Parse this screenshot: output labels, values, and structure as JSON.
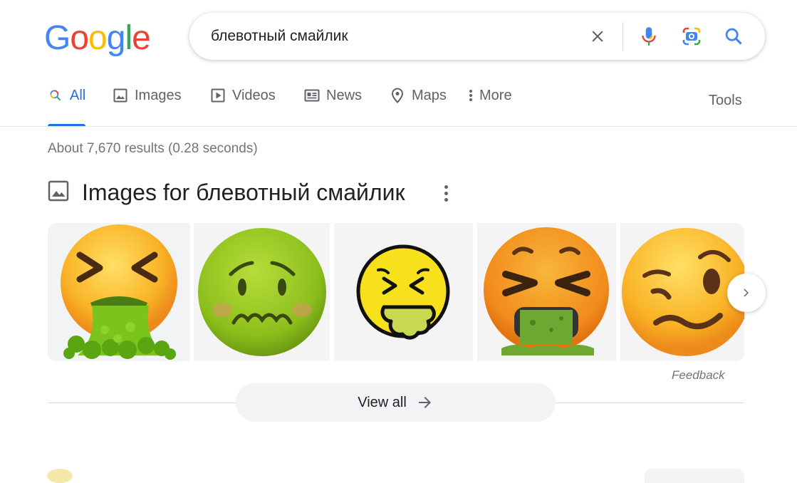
{
  "logo": {
    "letters": [
      {
        "ch": "G",
        "color": "#4285F4"
      },
      {
        "ch": "o",
        "color": "#EA4335"
      },
      {
        "ch": "o",
        "color": "#FBBC05"
      },
      {
        "ch": "g",
        "color": "#4285F4"
      },
      {
        "ch": "l",
        "color": "#34A853"
      },
      {
        "ch": "e",
        "color": "#EA4335"
      }
    ]
  },
  "search": {
    "value": "блевотный смайлик",
    "icons": [
      "clear-icon",
      "microphone-icon",
      "camera-lens-icon",
      "search-icon"
    ]
  },
  "tabs": [
    {
      "label": "All",
      "icon": "search-icon",
      "active": true
    },
    {
      "label": "Images",
      "icon": "image-icon",
      "active": false
    },
    {
      "label": "Videos",
      "icon": "play-icon",
      "active": false
    },
    {
      "label": "News",
      "icon": "newspaper-icon",
      "active": false
    },
    {
      "label": "Maps",
      "icon": "map-pin-icon",
      "active": false
    },
    {
      "label": "More",
      "icon": "more-vertical-icon",
      "active": false
    }
  ],
  "tools_label": "Tools",
  "result_stats": "About 7,670 results (0.28 seconds)",
  "images_section": {
    "title": "Images for блевотный смайлик",
    "thumbnails": [
      {
        "subject": "vomiting-face-emoji-apple"
      },
      {
        "subject": "nauseated-face-emoji"
      },
      {
        "subject": "vomiting-face-emoji-outline"
      },
      {
        "subject": "vomiting-face-emoji-google"
      },
      {
        "subject": "woozy-face-emoji"
      }
    ],
    "feedback_label": "Feedback",
    "view_all_label": "View all"
  },
  "colors": {
    "accent": "#1a73e8",
    "text": "#202124",
    "muted": "#5f6368",
    "stats": "#70757a",
    "chip_bg": "#f1f3f4"
  }
}
